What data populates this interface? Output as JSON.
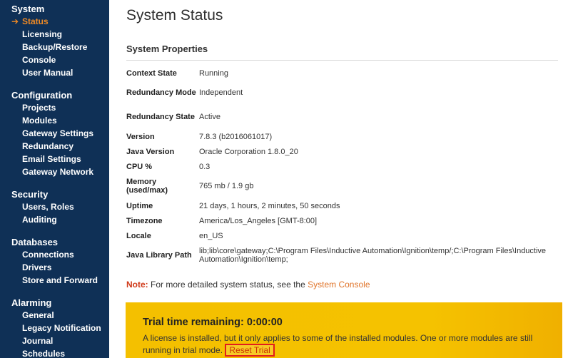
{
  "sidebar": {
    "groups": [
      {
        "heading": "System",
        "items": [
          {
            "label": "Status",
            "active": true
          },
          {
            "label": "Licensing"
          },
          {
            "label": "Backup/Restore"
          },
          {
            "label": "Console"
          },
          {
            "label": "User Manual"
          }
        ]
      },
      {
        "heading": "Configuration",
        "items": [
          {
            "label": "Projects"
          },
          {
            "label": "Modules"
          },
          {
            "label": "Gateway Settings"
          },
          {
            "label": "Redundancy"
          },
          {
            "label": "Email Settings"
          },
          {
            "label": "Gateway Network"
          }
        ]
      },
      {
        "heading": "Security",
        "items": [
          {
            "label": "Users, Roles"
          },
          {
            "label": "Auditing"
          }
        ]
      },
      {
        "heading": "Databases",
        "items": [
          {
            "label": "Connections"
          },
          {
            "label": "Drivers"
          },
          {
            "label": "Store and Forward"
          }
        ]
      },
      {
        "heading": "Alarming",
        "items": [
          {
            "label": "General"
          },
          {
            "label": "Legacy Notification"
          },
          {
            "label": "Journal"
          },
          {
            "label": "Schedules"
          }
        ]
      }
    ],
    "active_arrow": "➔"
  },
  "main": {
    "title": "System Status",
    "section_title": "System Properties",
    "properties": [
      {
        "key": "Context State",
        "value": "Running"
      },
      {
        "key": "Redundancy Mode",
        "value": "Independent"
      },
      {
        "key": "Redundancy State",
        "value": "Active"
      },
      {
        "key": "Version",
        "value": "7.8.3 (b2016061017)"
      },
      {
        "key": "Java Version",
        "value": "Oracle Corporation 1.8.0_20"
      },
      {
        "key": "CPU %",
        "value": "0.3"
      },
      {
        "key": "Memory (used/max)",
        "value": "765 mb / 1.9 gb"
      },
      {
        "key": "Uptime",
        "value": "21 days, 1 hours, 2 minutes, 50 seconds"
      },
      {
        "key": "Timezone",
        "value": "America/Los_Angeles [GMT-8:00]"
      },
      {
        "key": "Locale",
        "value": "en_US"
      },
      {
        "key": "Java Library Path",
        "value": "lib;lib\\core\\gateway;C:\\Program Files\\Inductive Automation\\Ignition\\temp/;C:\\Program Files\\Inductive Automation\\Ignition\\temp;"
      }
    ],
    "note": {
      "label": "Note:",
      "text": "For more detailed system status, see the",
      "link": "System Console"
    }
  },
  "trial": {
    "title": "Trial time remaining: 0:00:00",
    "text": "A license is installed, but it only applies to some of the installed modules. One or more modules are still running in trial mode.",
    "reset_label": "Reset Trial"
  },
  "colors": {
    "sidebar_bg": "#0f3056",
    "active": "#f08a24",
    "link": "#e0742a",
    "trial_bg": "#f4c000",
    "reset_border": "#e31c1c"
  }
}
